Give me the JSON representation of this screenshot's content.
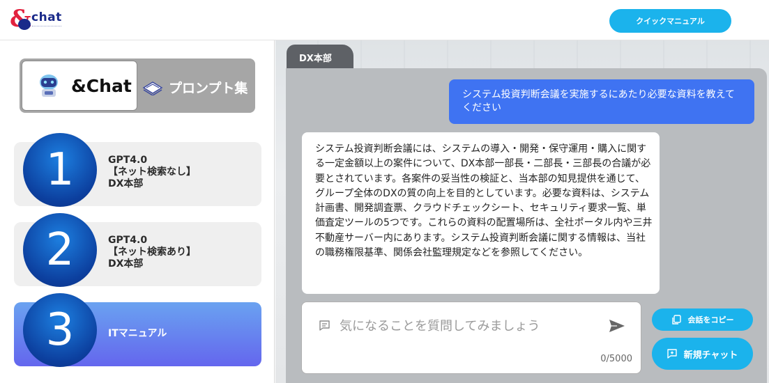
{
  "header": {
    "logo_amp": "&",
    "logo_word": "chat",
    "manual_button": "クイックマニュアル"
  },
  "mode_switch": {
    "chat_label": "&Chat",
    "prompt_label": "プロンプト集"
  },
  "models": [
    {
      "number": "1",
      "info": "GPT4.0\n【ネット検索なし】\nDX本部"
    },
    {
      "number": "2",
      "info": "GPT4.0\n【ネット検索あり】\nDX本部"
    },
    {
      "number": "3",
      "info": "ITマニュアル"
    }
  ],
  "chat": {
    "tab_label": "DX本部",
    "user_message": "システム投資判断会議を実施するにあたり必要な資料を教えてください",
    "bot_message": "システム投資判断会議には、システムの導入・開発・保守運用・購入に関する一定金額以上の案件について、DX本部一部長・二部長・三部長の合議が必要とされています。各案件の妥当性の検証と、当本部の知見提供を通じて、グループ全体のDXの質の向上を目的としています。必要な資料は、システム計画書、開発調査票、クラウドチェックシート、セキュリティ要求一覧、単価査定ツールの5つです。これらの資料の配置場所は、全社ポータル内や三井不動産サーバー内にあります。システム投資判断会議に関する情報は、当社の職務権限基準、関係会社監理規定などを参照してください。",
    "input_placeholder": "気になることを質問してみましょう",
    "input_value": "",
    "counter": "0/5000",
    "copy_button": "会話をコピー",
    "new_chat_button": "新規チャット"
  },
  "icons": {
    "logo": "and-chat-logo",
    "robot": "robot-icon",
    "book": "book-icon",
    "chat": "chat-bubble-icon",
    "send": "send-icon",
    "copy": "copy-icon",
    "new_chat": "new-chat-icon"
  },
  "colors": {
    "accent": "#1bb3ec",
    "user_bubble": "#3f73f2",
    "selected_model": "#6466ee",
    "number_circle": "#0c3f9e",
    "logo_red": "#e2213e",
    "logo_navy": "#1a2a8a"
  }
}
